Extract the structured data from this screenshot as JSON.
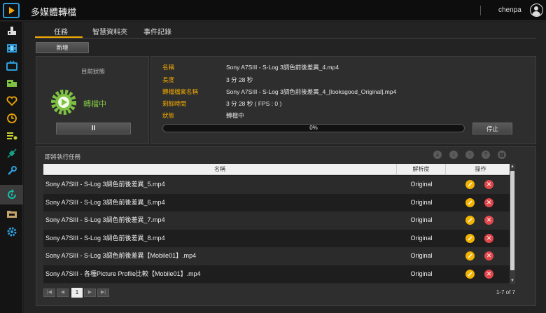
{
  "app": {
    "title": "多媒體轉檔",
    "username": "chenpa"
  },
  "sidebar": {
    "items": [
      {
        "icon": "import-icon"
      },
      {
        "icon": "film-icon"
      },
      {
        "icon": "tv-icon"
      },
      {
        "icon": "media-folder-icon"
      },
      {
        "icon": "heart-icon"
      },
      {
        "icon": "clock-icon"
      },
      {
        "icon": "playlist-icon"
      },
      {
        "icon": "satellite-icon"
      },
      {
        "icon": "wrench-icon"
      },
      {
        "icon": "transcode-icon",
        "active": true
      },
      {
        "icon": "folder-icon"
      },
      {
        "icon": "gear-icon"
      }
    ]
  },
  "tabs": [
    "任務",
    "智慧資料夾",
    "事件記錄"
  ],
  "toolbar": {
    "add_label": "新增"
  },
  "status": {
    "title": "目前狀態",
    "state": "轉檔中",
    "pause_label": "II"
  },
  "current_task": {
    "name_label": "名稱",
    "name": "Sony A7SIII - S-Log 3調色前後差異_4.mp4",
    "length_label": "長度",
    "length": "3 分 28 秒",
    "output_label": "轉檔檔案名稱",
    "output": "Sony A7SIII - S-Log 3調色前後差異_4_[looksgood_Original].mp4",
    "remaining_label": "剩餘時間",
    "remaining": "3 分 28 秒 ( FPS : 0 )",
    "state_label": "狀態",
    "state": "轉檔中",
    "progress_text": "0%",
    "progress_fraction": 0,
    "stop_label": "停止"
  },
  "queue": {
    "title": "即將執行任務",
    "columns": [
      "名稱",
      "解析度",
      "操作"
    ],
    "rows": [
      {
        "name": "Sony A7SIII - S-Log 3調色前後差異_5.mp4",
        "resolution": "Original"
      },
      {
        "name": "Sony A7SIII - S-Log 3調色前後差異_6.mp4",
        "resolution": "Original"
      },
      {
        "name": "Sony A7SIII - S-Log 3調色前後差異_7.mp4",
        "resolution": "Original"
      },
      {
        "name": "Sony A7SIII - S-Log 3調色前後差異_8.mp4",
        "resolution": "Original"
      },
      {
        "name": "Sony A7SIII - S-Log 3調色前後差異【Mobile01】.mp4",
        "resolution": "Original"
      },
      {
        "name": "Sony A7SIII - 各種Picture Profile比較【Mobile01】.mp4",
        "resolution": "Original"
      }
    ],
    "page": "1",
    "count": "1-7 of 7"
  },
  "colors": {
    "accent": "#f2a900",
    "running": "#7dc242",
    "delete": "#e2474b"
  }
}
